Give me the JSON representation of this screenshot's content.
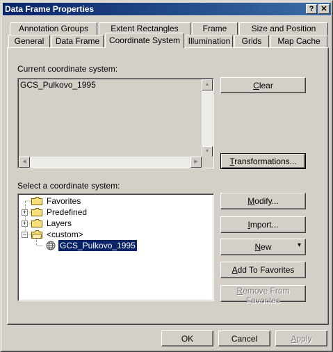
{
  "window": {
    "title": "Data Frame Properties",
    "help_label": "?",
    "close_label": "✕"
  },
  "tabs_row1": [
    "Annotation Groups",
    "Extent Rectangles",
    "Frame",
    "Size and Position"
  ],
  "tabs_row2": [
    "General",
    "Data Frame",
    "Coordinate System",
    "Illumination",
    "Grids",
    "Map Cache"
  ],
  "active_tab": "Coordinate System",
  "current": {
    "label": "Current coordinate system:",
    "value": "GCS_Pulkovo_1995"
  },
  "select": {
    "label": "Select a coordinate system:",
    "tree": [
      {
        "label": "Favorites",
        "expander": ""
      },
      {
        "label": "Predefined",
        "expander": "+"
      },
      {
        "label": "Layers",
        "expander": "+"
      },
      {
        "label": "<custom>",
        "expander": "−"
      },
      {
        "label": "GCS_Pulkovo_1995",
        "expander": "",
        "selected": true
      }
    ]
  },
  "buttons": {
    "clear": {
      "underline": "C",
      "rest": "lear"
    },
    "transformations": {
      "underline": "T",
      "rest": "ransformations..."
    },
    "modify": {
      "pre": "",
      "underline": "M",
      "rest": "odify..."
    },
    "import": {
      "underline": "I",
      "rest": "mport..."
    },
    "new": {
      "underline": "N",
      "rest": "ew",
      "arrow": "▾"
    },
    "add_favorites": {
      "pre": "",
      "underline": "A",
      "rest": "dd To Favorites"
    },
    "remove_favorites": {
      "underline": "R",
      "rest": "emove From Favorites"
    },
    "ok": "OK",
    "cancel": "Cancel",
    "apply": {
      "underline": "A",
      "rest": "pply"
    }
  },
  "colors": {
    "title_start": "#0a246a",
    "title_end": "#3a6ea5",
    "selection": "#0a246a",
    "face": "#d4d0c8"
  }
}
